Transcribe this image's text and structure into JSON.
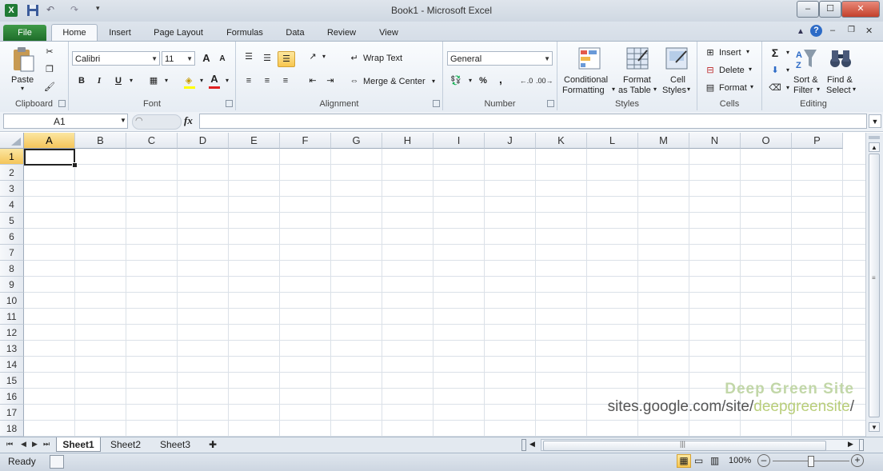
{
  "window": {
    "title": "Book1  -  Microsoft Excel",
    "minimize": "–",
    "maximize": "☐",
    "close": "✕"
  },
  "ribbon_tabs": [
    {
      "label": "File"
    },
    {
      "label": "Home"
    },
    {
      "label": "Insert"
    },
    {
      "label": "Page Layout"
    },
    {
      "label": "Formulas"
    },
    {
      "label": "Data"
    },
    {
      "label": "Review"
    },
    {
      "label": "View"
    }
  ],
  "clipboard": {
    "paste": "Paste",
    "group": "Clipboard"
  },
  "font": {
    "name": "Calibri",
    "size": "11",
    "group": "Font",
    "bold": "B",
    "italic": "I",
    "underline": "U",
    "grow": "A",
    "shrink": "A",
    "fontcolor": "A"
  },
  "alignment": {
    "wrap_text": "Wrap Text",
    "merge_center": "Merge & Center",
    "group": "Alignment"
  },
  "number": {
    "format": "General",
    "percent": "%",
    "comma": ",",
    "group": "Number"
  },
  "styles": {
    "conditional_1": "Conditional",
    "conditional_2": "Formatting",
    "format_table_1": "Format",
    "format_table_2": "as Table",
    "cell_styles_1": "Cell",
    "cell_styles_2": "Styles",
    "group": "Styles"
  },
  "cells": {
    "insert": "Insert",
    "delete": "Delete",
    "format": "Format",
    "group": "Cells"
  },
  "editing": {
    "sort_1": "Sort &",
    "sort_2": "Filter",
    "find_1": "Find &",
    "find_2": "Select",
    "group": "Editing",
    "sigma": "Σ"
  },
  "formula_bar": {
    "name_box": "A1",
    "fx": "fx",
    "value": ""
  },
  "columns": [
    "A",
    "B",
    "C",
    "D",
    "E",
    "F",
    "G",
    "H",
    "I",
    "J",
    "K",
    "L",
    "M",
    "N",
    "O",
    "P"
  ],
  "rows": [
    "1",
    "2",
    "3",
    "4",
    "5",
    "6",
    "7",
    "8",
    "9",
    "10",
    "11",
    "12",
    "13",
    "14",
    "15",
    "16",
    "17",
    "18"
  ],
  "sheets": [
    {
      "label": "Sheet1"
    },
    {
      "label": "Sheet2"
    },
    {
      "label": "Sheet3"
    }
  ],
  "status": {
    "ready": "Ready",
    "zoom": "100%"
  },
  "watermark": {
    "title": "Deep Green Site",
    "url_prefix": "sites.google.com/site/",
    "url_highlight": "deepgreensite",
    "url_suffix": "/"
  },
  "colors": {
    "file_tab": "#1f6d2a",
    "selected_header": "#f4c55a",
    "accent": "#3f9a48"
  }
}
